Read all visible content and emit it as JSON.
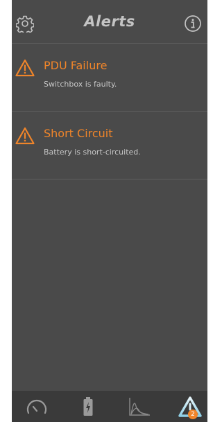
{
  "header": {
    "title": "Alerts",
    "left_icon": "gear-icon",
    "right_icon": "info-icon"
  },
  "alerts": [
    {
      "title": "PDU Failure",
      "message": "Switchbox is faulty.",
      "icon": "warning-triangle-icon"
    },
    {
      "title": "Short Circuit",
      "message": "Battery is short-circuited.",
      "icon": "warning-triangle-icon"
    }
  ],
  "tabbar": {
    "tabs": [
      {
        "icon": "gauge-icon",
        "active": false
      },
      {
        "icon": "battery-icon",
        "active": false
      },
      {
        "icon": "graph-icon",
        "active": false
      },
      {
        "icon": "alert-triangle-icon",
        "active": true
      }
    ],
    "alerts_badge": "2"
  },
  "colors": {
    "background": "#4a4a4a",
    "accent": "#f0852a",
    "tabbar": "#3a3a3a",
    "text_muted": "#c6c6c6"
  }
}
